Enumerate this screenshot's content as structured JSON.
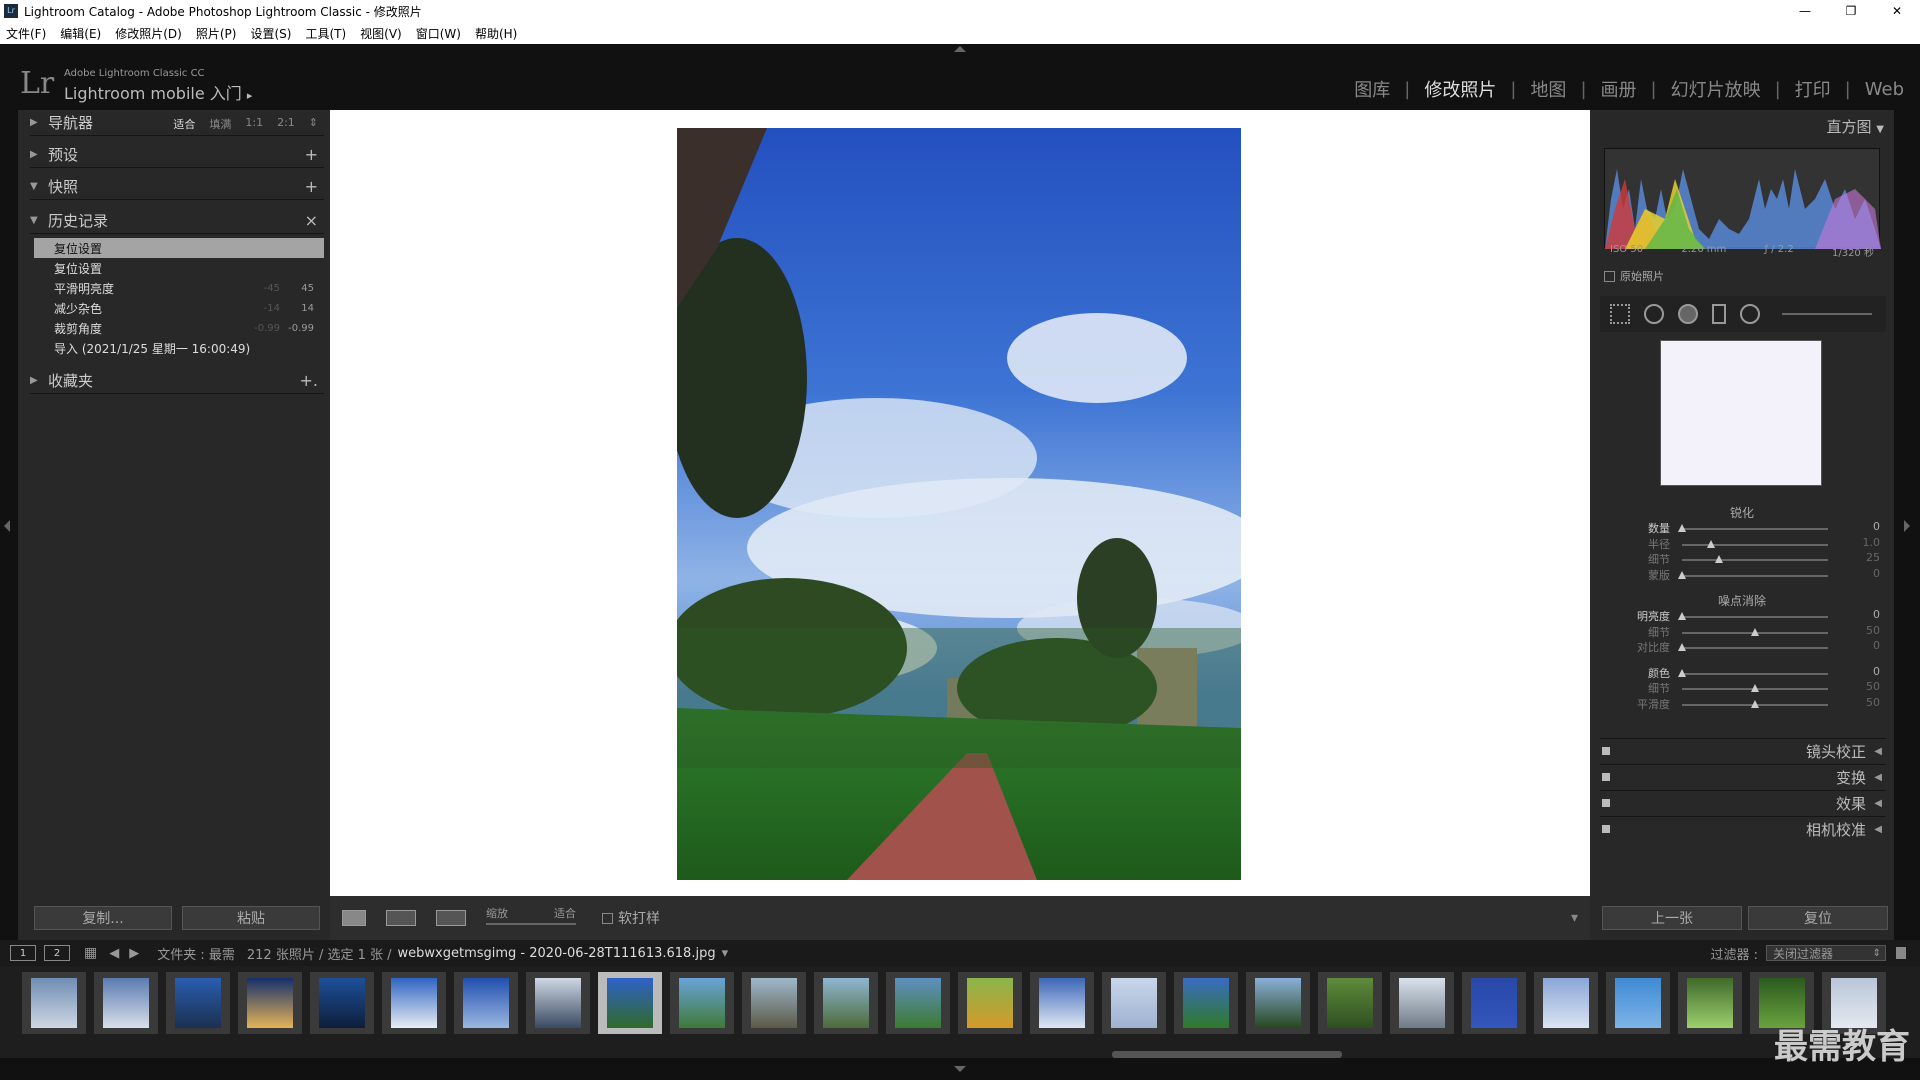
{
  "window": {
    "title": "Lightroom Catalog - Adobe Photoshop Lightroom Classic - 修改照片",
    "controls": [
      "—",
      "❐",
      "✕"
    ]
  },
  "menu": [
    "文件(F)",
    "编辑(E)",
    "修改照片(D)",
    "照片(P)",
    "设置(S)",
    "工具(T)",
    "视图(V)",
    "窗口(W)",
    "帮助(H)"
  ],
  "brand": {
    "logo": "Lr",
    "line1": "Adobe Lightroom Classic CC",
    "line2": "Lightroom mobile 入门",
    "arrow": "▸"
  },
  "modules": [
    {
      "label": "图库",
      "active": false
    },
    {
      "label": "修改照片",
      "active": true
    },
    {
      "label": "地图",
      "active": false
    },
    {
      "label": "画册",
      "active": false
    },
    {
      "label": "幻灯片放映",
      "active": false
    },
    {
      "label": "打印",
      "active": false
    },
    {
      "label": "Web",
      "active": false
    }
  ],
  "left": {
    "navigator": {
      "label": "导航器",
      "zoom": [
        "适合",
        "填满",
        "1:1",
        "2:1"
      ],
      "zoom_arrow": "⇕"
    },
    "presets": {
      "label": "预设",
      "action": "+"
    },
    "snapshots": {
      "label": "快照",
      "action": "+"
    },
    "history": {
      "label": "历史记录",
      "action": "×"
    },
    "history_items": [
      {
        "label": "复位设置",
        "a": "",
        "b": "",
        "selected": true
      },
      {
        "label": "复位设置",
        "a": "",
        "b": "",
        "selected": false
      },
      {
        "label": "平滑明亮度",
        "a": "-45",
        "b": "45",
        "selected": false
      },
      {
        "label": "减少杂色",
        "a": "-14",
        "b": "14",
        "selected": false
      },
      {
        "label": "裁剪角度",
        "a": "-0.99",
        "b": "-0.99",
        "selected": false
      },
      {
        "label": "导入 (2021/1/25 星期一 16:00:49)",
        "a": "",
        "b": "",
        "selected": false
      }
    ],
    "collections": {
      "label": "收藏夹",
      "action": "+."
    },
    "copy": "复制...",
    "paste": "粘贴"
  },
  "toolbar": {
    "zoom_label": "缩放",
    "zoom_value": "适合",
    "softproof": "软打样",
    "menu_arrow": "▾"
  },
  "right": {
    "histogram": "直方图",
    "histogram_arrow": "▼",
    "exif": [
      "ISO 50",
      "2.26 mm",
      "ƒ / 2.2",
      "1/320 秒"
    ],
    "original": "原始照片",
    "sharpen": {
      "title": "锐化",
      "rows": [
        {
          "label": "数量",
          "value": "0",
          "pos": 0.0,
          "dim": false
        },
        {
          "label": "半径",
          "value": "1.0",
          "pos": 0.2,
          "dim": true
        },
        {
          "label": "细节",
          "value": "25",
          "pos": 0.25,
          "dim": true
        },
        {
          "label": "蒙版",
          "value": "0",
          "pos": 0.0,
          "dim": true
        }
      ]
    },
    "noise": {
      "title": "噪点消除",
      "rows": [
        {
          "label": "明亮度",
          "value": "0",
          "pos": 0.0,
          "dim": false
        },
        {
          "label": "细节",
          "value": "50",
          "pos": 0.5,
          "dim": true
        },
        {
          "label": "对比度",
          "value": "0",
          "pos": 0.0,
          "dim": true
        },
        {
          "label": "颜色",
          "value": "0",
          "pos": 0.0,
          "dim": false
        },
        {
          "label": "细节",
          "value": "50",
          "pos": 0.5,
          "dim": true
        },
        {
          "label": "平滑度",
          "value": "50",
          "pos": 0.5,
          "dim": true
        }
      ]
    },
    "collapsed_panels": [
      "镜头校正",
      "变换",
      "效果",
      "相机校准"
    ],
    "collapsed_arrow": "◀",
    "prev": "上一张",
    "reset": "复位"
  },
  "filmstrip_bar": {
    "monitor1": "1",
    "monitor2": "2",
    "grid": "▦",
    "back": "◀",
    "forward": "▶",
    "source": "文件夹 : 最需",
    "count": "212 张照片 / 选定 1 张 /",
    "filename": "webwxgetmsgimg - 2020-06-28T111613.618.jpg",
    "filename_arrow": "▾",
    "filter_label": "过滤器 :",
    "filter_value": "关闭过滤器",
    "filter_arrow": "⇕"
  },
  "thumbnails": [
    {
      "c1": "#6f8db5",
      "c2": "#cfd7e2",
      "selected": false
    },
    {
      "c1": "#5a7bb0",
      "c2": "#d9e0ea",
      "selected": false
    },
    {
      "c1": "#2a5db0",
      "c2": "#1c3050",
      "selected": false
    },
    {
      "c1": "#14306b",
      "c2": "#e5b357",
      "selected": false
    },
    {
      "c1": "#1d4f9a",
      "c2": "#0e1f3a",
      "selected": false
    },
    {
      "c1": "#2f64c3",
      "c2": "#e8edf3",
      "selected": false
    },
    {
      "c1": "#214fae",
      "c2": "#9cb8e0",
      "selected": false
    },
    {
      "c1": "#cfd8e3",
      "c2": "#3a4a62",
      "selected": false
    },
    {
      "c1": "#2f61c9",
      "c2": "#2f6a2a",
      "selected": true
    },
    {
      "c1": "#6aa3d8",
      "c2": "#3f7a39",
      "selected": false
    },
    {
      "c1": "#9fb8cc",
      "c2": "#5c5a47",
      "selected": false
    },
    {
      "c1": "#8fb5d0",
      "c2": "#4d6b3a",
      "selected": false
    },
    {
      "c1": "#5f8fc2",
      "c2": "#3c7b31",
      "selected": false
    },
    {
      "c1": "#89b54a",
      "c2": "#d49a2a",
      "selected": false
    },
    {
      "c1": "#3d67b8",
      "c2": "#dfe7f3",
      "selected": false
    },
    {
      "c1": "#c8d6ea",
      "c2": "#9fb2d0",
      "selected": false
    },
    {
      "c1": "#3a6cc0",
      "c2": "#2f7a2a",
      "selected": false
    },
    {
      "c1": "#8ab0d8",
      "c2": "#27471f",
      "selected": false
    },
    {
      "c1": "#5e8b3a",
      "c2": "#2e4f22",
      "selected": false
    },
    {
      "c1": "#d9e2ec",
      "c2": "#6f7b86",
      "selected": false
    },
    {
      "c1": "#2848a8",
      "c2": "#3356bd",
      "selected": false
    },
    {
      "c1": "#8aa6d6",
      "c2": "#dbe4f2",
      "selected": false
    },
    {
      "c1": "#3e8ad4",
      "c2": "#7fb4e6",
      "selected": false
    },
    {
      "c1": "#3f6a2b",
      "c2": "#9ccf6c",
      "selected": false
    },
    {
      "c1": "#2c5a1f",
      "c2": "#6aa33f",
      "selected": false
    },
    {
      "c1": "#b9c6d8",
      "c2": "#e4e9f0",
      "selected": false
    }
  ],
  "watermark": "最需教育"
}
